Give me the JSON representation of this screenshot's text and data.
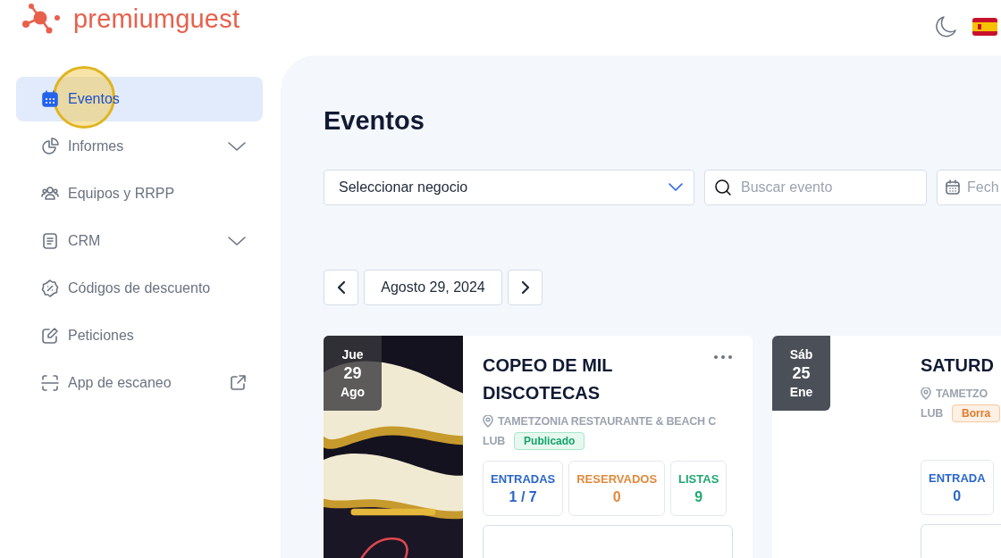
{
  "logo": {
    "text": "premiumguest"
  },
  "sidebar": {
    "items": [
      {
        "label": "Eventos",
        "kind": "calendar",
        "selected": true
      },
      {
        "label": "Informes",
        "kind": "pie",
        "selected": false,
        "expandable": true
      },
      {
        "label": "Equipos y RRPP",
        "kind": "people",
        "selected": false
      },
      {
        "label": "CRM",
        "kind": "document",
        "selected": false,
        "expandable": true
      },
      {
        "label": "Códigos de descuento",
        "kind": "discount",
        "selected": false
      },
      {
        "label": "Peticiones",
        "kind": "edit",
        "selected": false
      },
      {
        "label": "App de escaneo",
        "kind": "scan",
        "selected": false,
        "external": true
      }
    ]
  },
  "page": {
    "title": "Eventos"
  },
  "filters": {
    "business": {
      "value": "Seleccionar negocio"
    },
    "search": {
      "placeholder": "Buscar evento"
    },
    "date": {
      "placeholder": "Fech"
    }
  },
  "date_nav": {
    "date": "Agosto 29, 2024"
  },
  "events": [
    {
      "weekday": "Jue",
      "day": "29",
      "month": "Ago",
      "has_picture": true,
      "title": "COPEO DE MIL DISCOTECAS",
      "location_lines": [
        "TAMETZONIA RESTAURANTE & BEACH C",
        "LUB"
      ],
      "status": {
        "label": "Publicado",
        "kind": "published"
      },
      "menu": true,
      "stats": [
        {
          "kind": "tickets",
          "label": "ENTRADAS",
          "value": "1 / 7"
        },
        {
          "kind": "reserved",
          "label": "RESERVADOS",
          "value": "0"
        },
        {
          "kind": "lists",
          "label": "LISTAS",
          "value": "9"
        }
      ]
    },
    {
      "weekday": "Sáb",
      "day": "25",
      "month": "Ene",
      "has_picture": false,
      "title": "SATURD",
      "location_lines": [
        "TAMETZO",
        "LUB"
      ],
      "status": {
        "label": "Borra",
        "kind": "draft"
      },
      "menu": false,
      "stats": [
        {
          "kind": "tickets",
          "label": "ENTRADA",
          "value": "0"
        }
      ]
    }
  ]
}
